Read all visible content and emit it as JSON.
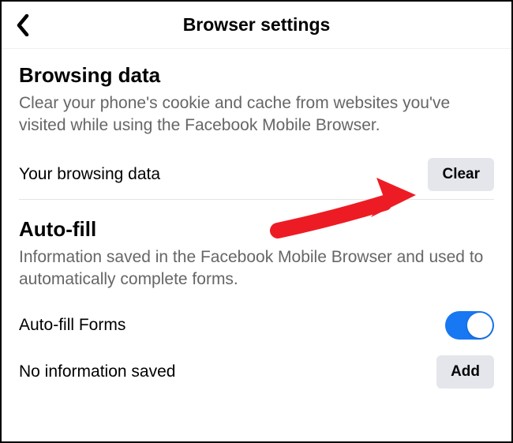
{
  "header": {
    "title": "Browser settings"
  },
  "browsing_data": {
    "title": "Browsing data",
    "description": "Clear your phone's cookie and cache from websites you've visited while using the Facebook Mobile Browser.",
    "row_label": "Your browsing data",
    "clear_button": "Clear"
  },
  "auto_fill": {
    "title": "Auto-fill",
    "description": "Information saved in the Facebook Mobile Browser and used to automatically complete forms.",
    "forms_label": "Auto-fill Forms",
    "no_info_label": "No information saved",
    "add_button": "Add",
    "toggle_on": true
  },
  "colors": {
    "accent": "#1877f2",
    "annotation": "#ed1c24"
  }
}
